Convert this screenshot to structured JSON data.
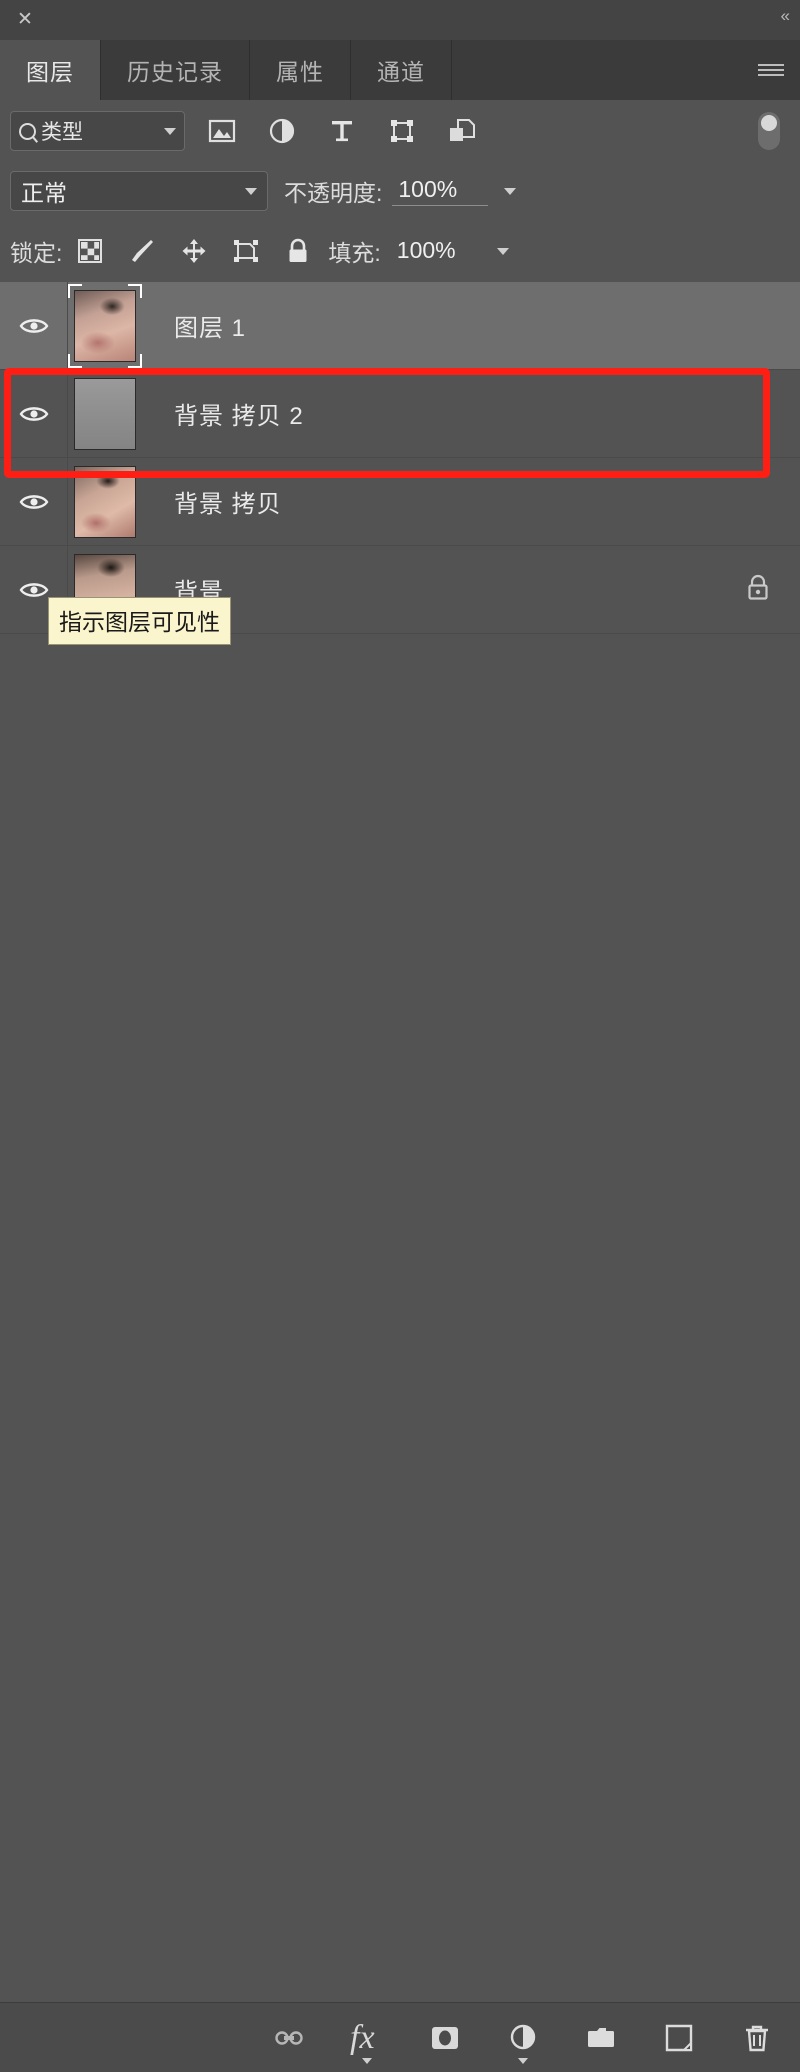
{
  "window": {
    "close_label": "✕",
    "collapse_label": "«"
  },
  "tabs": [
    {
      "label": "图层",
      "active": true
    },
    {
      "label": "历史记录",
      "active": false
    },
    {
      "label": "属性",
      "active": false
    },
    {
      "label": "通道",
      "active": false
    }
  ],
  "panel_menu_name": "panel-menu-icon",
  "filter": {
    "type_label": "类型",
    "icons": [
      "pixel-layer-filter-icon",
      "adjustment-layer-filter-icon",
      "type-layer-filter-icon",
      "shape-layer-filter-icon",
      "smart-object-filter-icon"
    ],
    "toggle_name": "filter-enable-toggle"
  },
  "blend": {
    "mode": "正常",
    "opacity_label": "不透明度:",
    "opacity_value": "100%"
  },
  "lock": {
    "label": "锁定:",
    "icons": [
      "lock-transparent-pixels-icon",
      "lock-image-pixels-icon",
      "lock-position-icon",
      "lock-artboard-nesting-icon",
      "lock-all-icon"
    ],
    "fill_label": "填充:",
    "fill_value": "100%"
  },
  "layers": [
    {
      "name": "图层 1",
      "visible": true,
      "selected": true,
      "thumb": "face1",
      "locked": false,
      "has_selection_corners": true
    },
    {
      "name": "背景 拷贝 2",
      "visible": true,
      "selected": false,
      "thumb": "gray",
      "locked": false,
      "has_selection_corners": false
    },
    {
      "name": "背景 拷贝",
      "visible": true,
      "selected": false,
      "thumb": "face2",
      "locked": false,
      "has_selection_corners": false
    },
    {
      "name": "背景",
      "visible": true,
      "selected": false,
      "thumb": "face3",
      "locked": true,
      "has_selection_corners": false
    }
  ],
  "tooltip": {
    "text": "指示图层可见性"
  },
  "annotation": {
    "color": "#ff1e14"
  },
  "bottom_bar": {
    "buttons": [
      "link-layers-icon",
      "layer-effects-fx-icon",
      "add-layer-mask-icon",
      "new-adjustment-layer-icon",
      "new-group-icon",
      "new-layer-icon",
      "delete-layer-icon"
    ],
    "fx_label": "fx"
  }
}
